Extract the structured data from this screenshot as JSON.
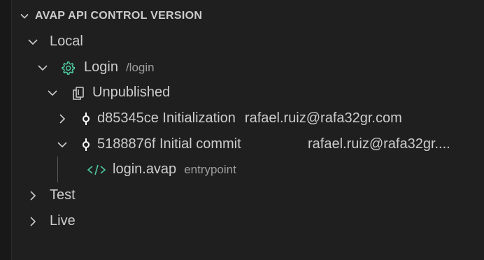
{
  "section": {
    "title": "AVAP API CONTROL VERSION"
  },
  "tree": {
    "local": {
      "label": "Local"
    },
    "login": {
      "label": "Login",
      "description": "/login"
    },
    "unpublished": {
      "label": "Unpublished"
    },
    "commit1": {
      "label": "d85345ce Initialization",
      "author": "rafael.ruiz@rafa32gr.com"
    },
    "commit2": {
      "label": "5188876f Initial commit",
      "author": "rafael.ruiz@rafa32gr...."
    },
    "file": {
      "label": "login.avap",
      "description": "entrypoint"
    },
    "test": {
      "label": "Test"
    },
    "live": {
      "label": "Live"
    }
  },
  "colors": {
    "background": "#1f1f1f",
    "text": "#cccccc",
    "muted": "#9d9d9d",
    "gear_icon": "#4ec9a0",
    "code_icon": "#4ec9a0"
  },
  "icons": {
    "section_chevron": "chevron-down-icon",
    "gear": "gear-icon",
    "copy": "copy-icon",
    "commit": "git-commit-icon",
    "code": "code-icon"
  }
}
